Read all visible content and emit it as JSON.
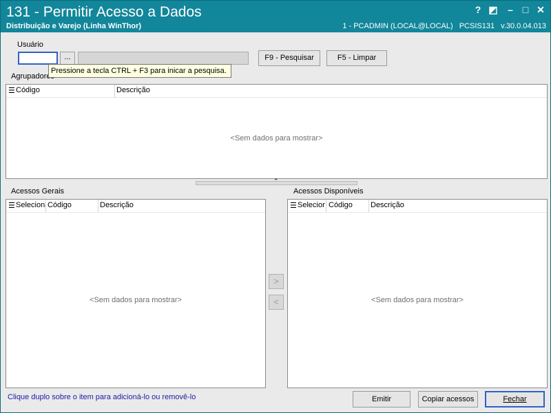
{
  "window": {
    "title": "131 - Permitir Acesso a Dados",
    "subtitle": "Distribuição e Varejo (Linha WinThor)",
    "status_user": "1 - PCADMIN (LOCAL@LOCAL)",
    "status_app": "PCSIS131",
    "status_version": "v.30.0.04.013",
    "buttons": {
      "help": "?",
      "restore": "◩",
      "minimize": "–",
      "maximize": "□",
      "close": "✕"
    }
  },
  "user_section": {
    "label": "Usuário",
    "code_value": "",
    "browse_label": "...",
    "name_value": "",
    "search_button": "F9 - Pesquisar",
    "clear_button": "F5 - Limpar",
    "tooltip": "Pressione a tecla CTRL + F3 para inicar a pesquisa."
  },
  "agrupadores": {
    "label": "Agrupadores",
    "columns": [
      "Código",
      "Descrição"
    ],
    "empty": "<Sem dados para mostrar>"
  },
  "acessos_gerais": {
    "label": "Acessos Gerais",
    "columns": [
      "Selecionar",
      "Código",
      "Descrição"
    ],
    "empty": "<Sem dados para mostrar>"
  },
  "acessos_disponiveis": {
    "label": "Acessos Disponíveis",
    "columns": [
      "Selecionar",
      "Código",
      "Descrição"
    ],
    "empty": "<Sem dados para mostrar>"
  },
  "move": {
    "add": ">",
    "remove": "<"
  },
  "footer": {
    "hint": "Clique duplo sobre o item para adicioná-lo ou removê-lo",
    "emit": "Emitir",
    "copy": "Copiar acessos",
    "close": "Fechar"
  },
  "colors": {
    "titlebar": "#12869a",
    "window_bg": "#eaeaea",
    "hint_text": "#1a1aa6",
    "tooltip_bg": "#ffffe1"
  }
}
